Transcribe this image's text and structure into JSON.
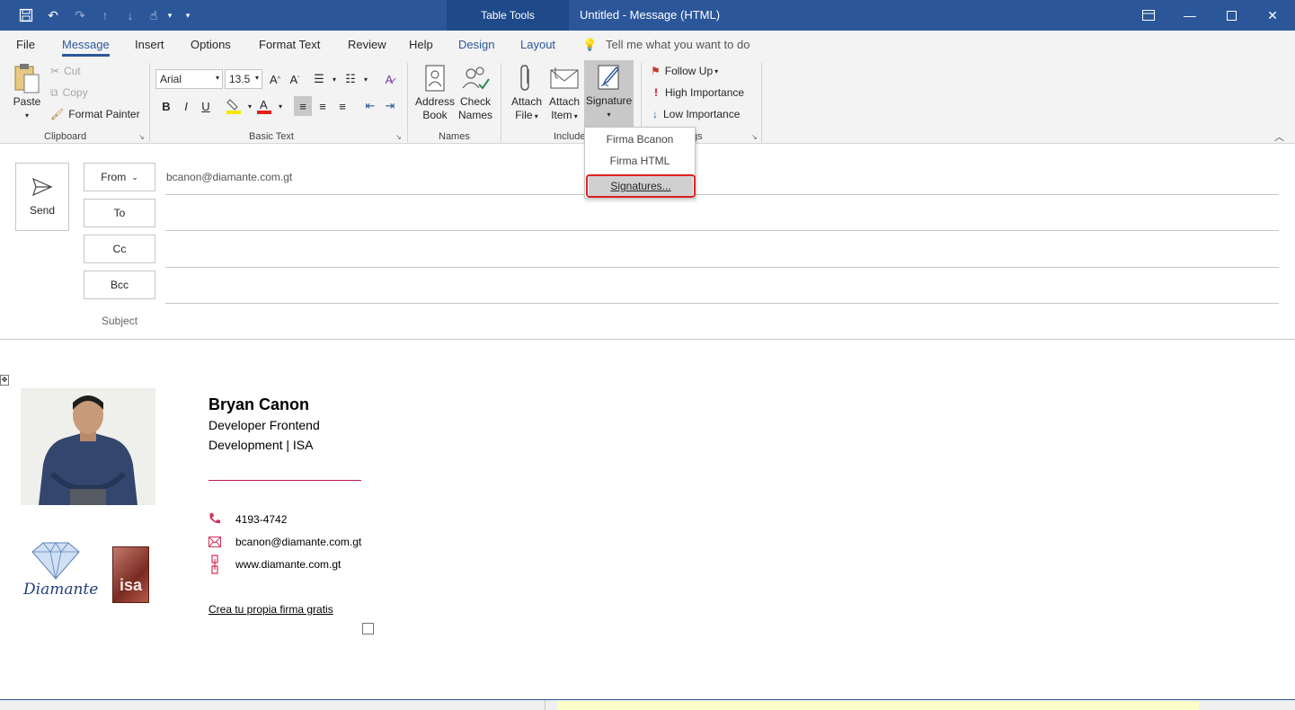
{
  "window": {
    "context_tab": "Table Tools",
    "title": "Untitled  -  Message (HTML)"
  },
  "menu": {
    "file": "File",
    "message": "Message",
    "insert": "Insert",
    "options": "Options",
    "format_text": "Format Text",
    "review": "Review",
    "help": "Help",
    "design": "Design",
    "layout": "Layout",
    "tell_me": "Tell me what you want to do"
  },
  "ribbon": {
    "clipboard": {
      "paste": "Paste",
      "cut": "Cut",
      "copy": "Copy",
      "format_painter": "Format Painter",
      "label": "Clipboard"
    },
    "basic_text": {
      "font": "Arial",
      "size": "13.5",
      "bold": "B",
      "italic": "I",
      "underline": "U",
      "label": "Basic Text"
    },
    "names": {
      "address_book_1": "Address",
      "address_book_2": "Book",
      "check_names_1": "Check",
      "check_names_2": "Names",
      "label": "Names"
    },
    "include": {
      "attach_file_1": "Attach",
      "attach_file_2": "File",
      "attach_item_1": "Attach",
      "attach_item_2": "Item",
      "signature": "Signature",
      "label": "Include"
    },
    "tags": {
      "follow_up": "Follow Up",
      "high_importance": "High Importance",
      "low_importance": "Low Importance",
      "label": "gs"
    }
  },
  "signature_menu": {
    "items": [
      "Firma Bcanon",
      "Firma HTML",
      "Signatures..."
    ]
  },
  "header": {
    "send": "Send",
    "from_label": "From",
    "from_value": "bcanon@diamante.com.gt",
    "to_label": "To",
    "cc_label": "Cc",
    "bcc_label": "Bcc",
    "subject_label": "Subject"
  },
  "signature": {
    "name": "Bryan Canon",
    "role": "Developer Frontend",
    "dept": "Development | ISA",
    "phone": "4193-4742",
    "email": "bcanon@diamante.com.gt",
    "web": "www.diamante.com.gt",
    "logo1_text": "Diamante",
    "logo2_text": "isa",
    "cta": "Crea tu propia firma gratis"
  },
  "colors": {
    "title_bar": "#2b579a",
    "accent": "#2b579a",
    "signature_accent": "#c2185b",
    "highlight_outline": "#e02020"
  }
}
